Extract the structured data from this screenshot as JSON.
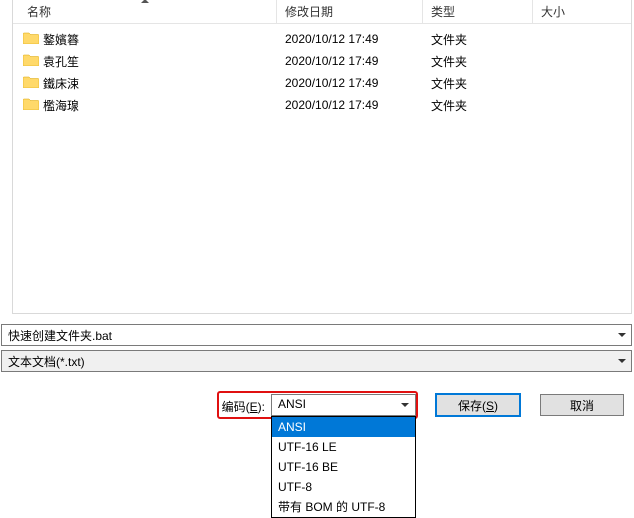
{
  "columns": {
    "name": "名称",
    "date": "修改日期",
    "type": "类型",
    "size": "大小"
  },
  "rows": [
    {
      "name": "鐜嬪簭",
      "date": "2020/10/12 17:49",
      "type": "文件夹"
    },
    {
      "name": "袁孔笙",
      "date": "2020/10/12 17:49",
      "type": "文件夹"
    },
    {
      "name": "鐵床涑",
      "date": "2020/10/12 17:49",
      "type": "文件夹"
    },
    {
      "name": "檻海瑔",
      "date": "2020/10/12 17:49",
      "type": "文件夹"
    }
  ],
  "filename": {
    "value": "快速创建文件夹.bat"
  },
  "filetype": {
    "value": "文本文档(*.txt)"
  },
  "encoding": {
    "label_pre": "编码(",
    "label_key": "E",
    "label_post": "):",
    "selected": "ANSI",
    "options": [
      "ANSI",
      "UTF-16 LE",
      "UTF-16 BE",
      "UTF-8",
      "带有 BOM 的 UTF-8"
    ]
  },
  "buttons": {
    "save_pre": "保存(",
    "save_key": "S",
    "save_post": ")",
    "cancel": "取消"
  }
}
